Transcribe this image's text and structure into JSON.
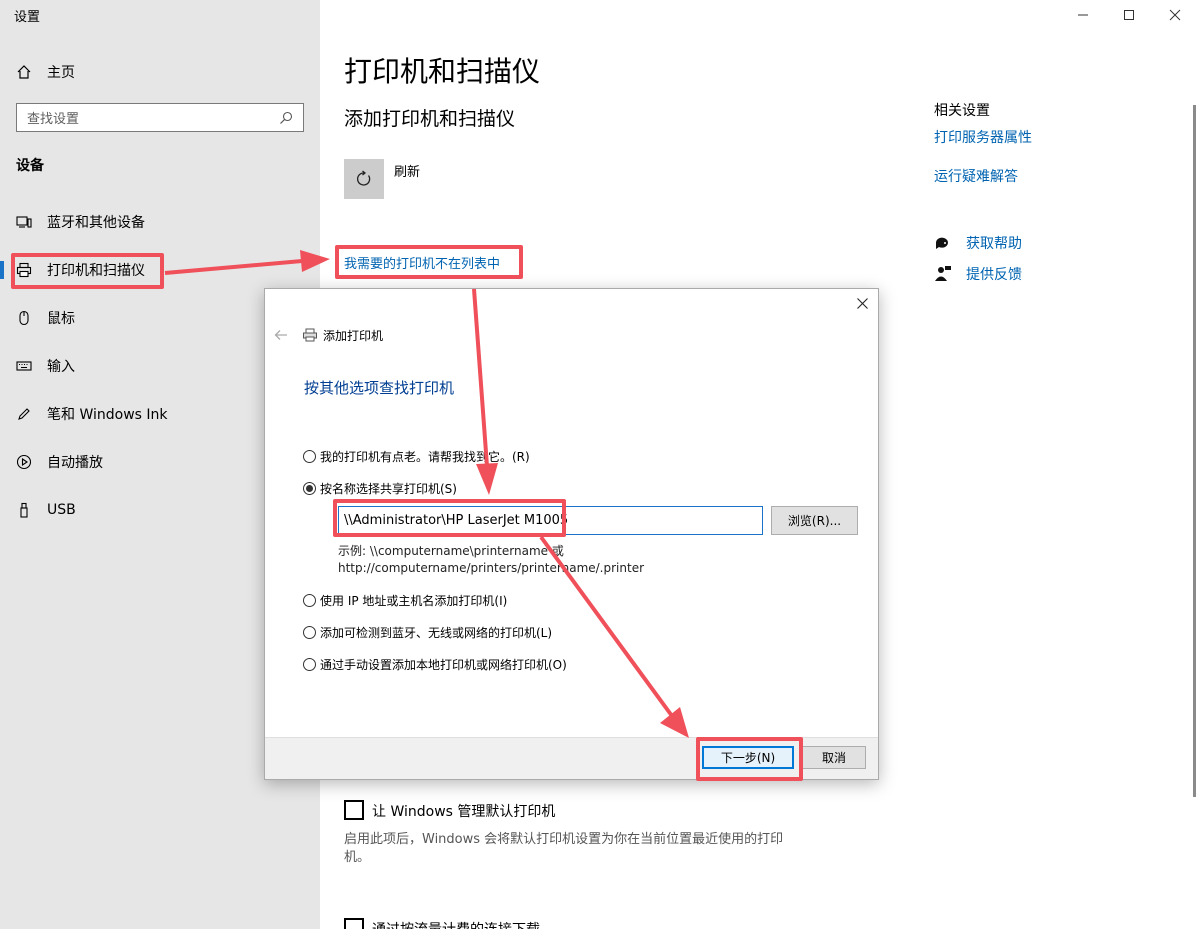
{
  "app": {
    "title": "设置"
  },
  "sidebar": {
    "home_label": "主页",
    "search_placeholder": "查找设置",
    "section": "设备",
    "items": [
      {
        "label": "蓝牙和其他设备",
        "icon": "bluetooth-devices-icon"
      },
      {
        "label": "打印机和扫描仪",
        "icon": "printer-icon",
        "active": true
      },
      {
        "label": "鼠标",
        "icon": "mouse-icon"
      },
      {
        "label": "输入",
        "icon": "keyboard-icon"
      },
      {
        "label": "笔和 Windows Ink",
        "icon": "pen-icon"
      },
      {
        "label": "自动播放",
        "icon": "autoplay-icon"
      },
      {
        "label": "USB",
        "icon": "usb-icon"
      }
    ]
  },
  "main": {
    "title": "打印机和扫描仪",
    "subtitle": "添加打印机和扫描仪",
    "refresh_label": "刷新",
    "not_listed_link": "我需要的打印机不在列表中",
    "default_printer": {
      "label": "让 Windows 管理默认打印机",
      "checked": false,
      "description": "启用此项后，Windows 会将默认打印机设置为你在当前位置最近使用的打印机。"
    },
    "metered_label": "通过按流量计费的连接下载"
  },
  "related": {
    "title": "相关设置",
    "links": [
      "打印服务器属性",
      "运行疑难解答"
    ],
    "help": "获取帮助",
    "feedback": "提供反馈"
  },
  "dialog": {
    "title": "添加打印机",
    "heading": "按其他选项查找打印机",
    "options": [
      {
        "label": "我的打印机有点老。请帮我找到它。(R)",
        "selected": false
      },
      {
        "label": "按名称选择共享打印机(S)",
        "selected": true
      },
      {
        "label": "使用 IP 地址或主机名添加打印机(I)",
        "selected": false
      },
      {
        "label": "添加可检测到蓝牙、无线或网络的打印机(L)",
        "selected": false
      },
      {
        "label": "通过手动设置添加本地打印机或网络打印机(O)",
        "selected": false
      }
    ],
    "share_name_value": "\\\\Administrator\\HP LaserJet M1005",
    "browse_label": "浏览(R)...",
    "example_line1": "示例: \\\\computername\\printername 或",
    "example_line2": "http://computername/printers/printername/.printer",
    "next_label": "下一步(N)",
    "cancel_label": "取消"
  },
  "colors": {
    "accent": "#0063b1",
    "highlight": "#f0505a",
    "sidebar_bg": "#e6e6e6",
    "dialog_heading": "#003e92"
  }
}
